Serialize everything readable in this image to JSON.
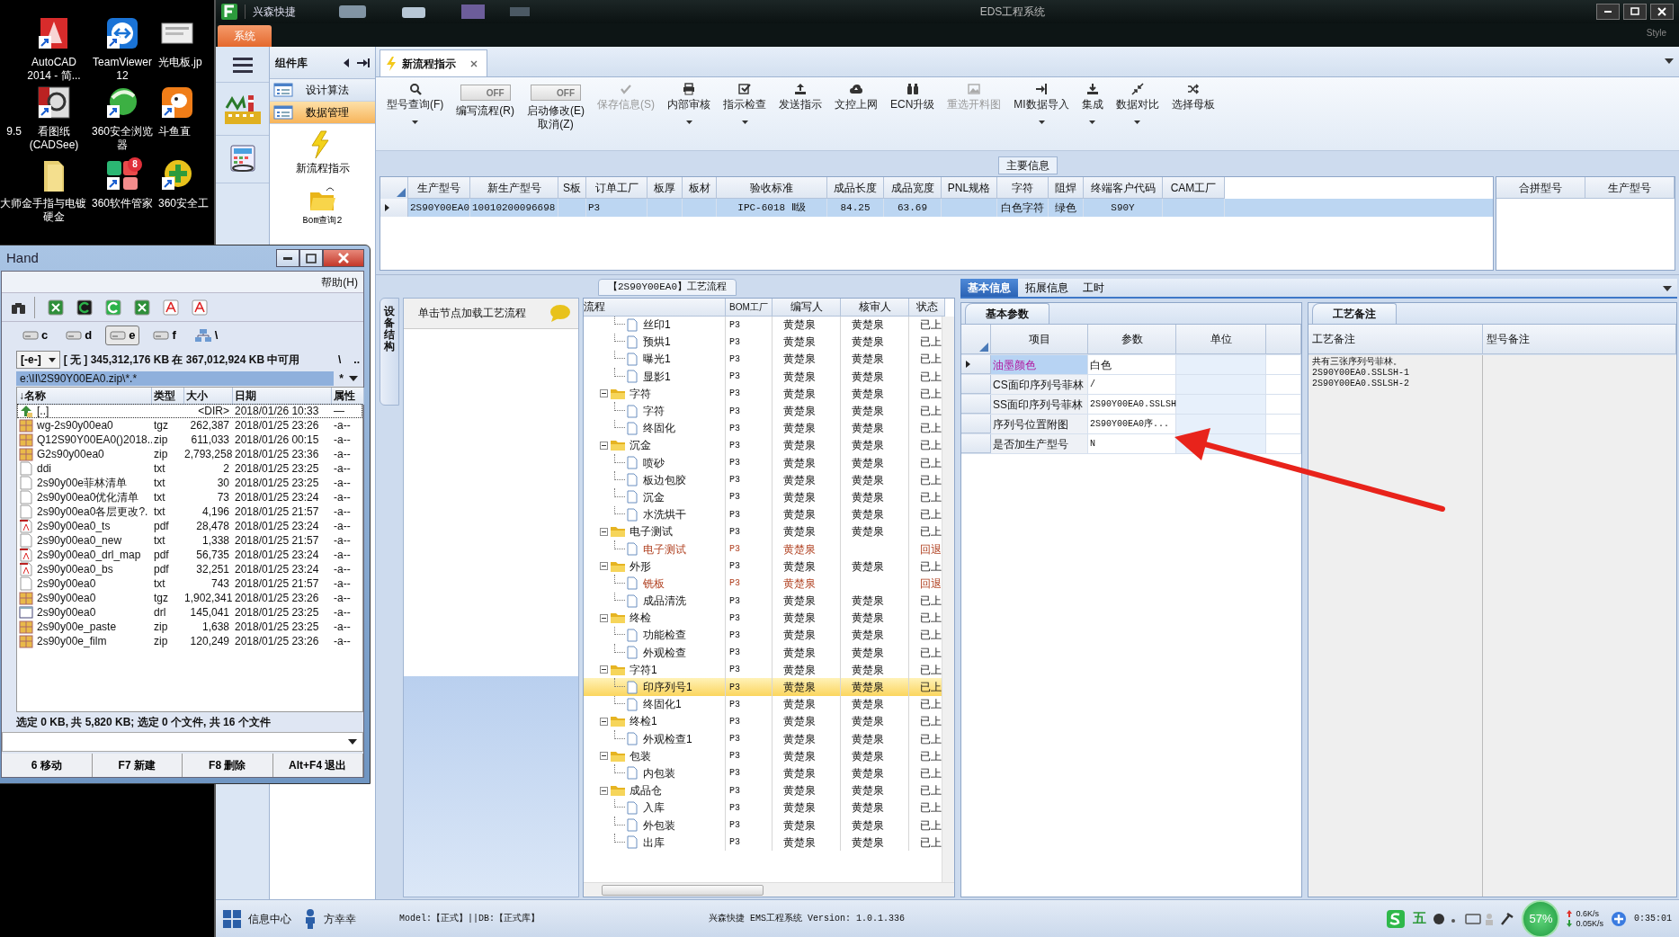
{
  "desktop": {
    "icons": [
      {
        "label": "AutoCAD 2014 - 简..."
      },
      {
        "label": "TeamViewer 12"
      },
      {
        "label": "光电板.jp"
      },
      {
        "label": "9.5"
      },
      {
        "label": "看图纸 (CADSee)"
      },
      {
        "label": "360安全浏览器"
      },
      {
        "label": "斗鱼直"
      },
      {
        "label": "大师"
      },
      {
        "label": "金手指与电镀硬金"
      },
      {
        "label": "360软件管家",
        "badge": "8"
      },
      {
        "label": "360安全工"
      }
    ]
  },
  "app": {
    "brand": "兴森快捷",
    "title": "EDS工程系统",
    "style_label": "Style",
    "ribbon_tab": {
      "label": "系统",
      "selected": true
    },
    "sidebar": {
      "title": "组件库",
      "items": [
        {
          "label": "设计算法",
          "selected": false
        },
        {
          "label": "数据管理",
          "selected": true
        }
      ],
      "shortcuts": [
        {
          "label": "新流程指示"
        },
        {
          "label": "Bom查询2"
        }
      ]
    },
    "doc_tab": {
      "label": "新流程指示"
    },
    "toolbar": [
      {
        "kind": "button",
        "label": "型号查询(F)",
        "dropdown": true,
        "disabled": false
      },
      {
        "kind": "toggle",
        "switch": "OFF",
        "on": false,
        "label": "编写流程(R)"
      },
      {
        "kind": "toggle",
        "switch": "OFF",
        "on": false,
        "label": "启动修改(E)\n取消(Z)"
      },
      {
        "kind": "button",
        "label": "保存信息(S)",
        "dropdown": false,
        "disabled": true
      },
      {
        "kind": "button",
        "label": "内部审核",
        "dropdown": true,
        "disabled": false
      },
      {
        "kind": "button",
        "label": "指示检查",
        "dropdown": true,
        "disabled": false
      },
      {
        "kind": "button",
        "label": "发送指示",
        "dropdown": false,
        "disabled": false
      },
      {
        "kind": "button",
        "label": "文控上网",
        "dropdown": false,
        "disabled": false
      },
      {
        "kind": "button",
        "label": "ECN升级",
        "dropdown": false,
        "disabled": false
      },
      {
        "kind": "button",
        "label": "重选开料图",
        "dropdown": false,
        "disabled": true
      },
      {
        "kind": "button",
        "label": "MI数据导入",
        "dropdown": true,
        "disabled": false
      },
      {
        "kind": "button",
        "label": "集成",
        "dropdown": true,
        "disabled": false
      },
      {
        "kind": "button",
        "label": "数据对比",
        "dropdown": true,
        "disabled": false
      },
      {
        "kind": "button",
        "label": "选择母板",
        "dropdown": false,
        "disabled": false
      }
    ],
    "main_info": {
      "title": "主要信息",
      "columns": [
        "生产型号",
        "新生产型号",
        "S板",
        "订单工厂",
        "板厚",
        "板材",
        "验收标准",
        "成品长度",
        "成品宽度",
        "PNL规格",
        "字符",
        "阻焊",
        "终端客户代码",
        "CAM工厂"
      ],
      "rows": [
        {
          "selected": true,
          "cells": [
            "2S90Y00EA0",
            "10010200096698",
            null,
            "P3",
            null,
            null,
            "IPC-6018 Ⅱ级",
            "84.25",
            "63.69",
            null,
            "白色字符",
            "绿色",
            "S90Y",
            null
          ]
        }
      ],
      "side_columns": [
        "合拼型号",
        "生产型号"
      ]
    },
    "process": {
      "title": "【2S90Y00EA0】工艺流程",
      "side_tab": "设备结构",
      "hint": "单击节点加载工艺流程",
      "columns": [
        "流程",
        "BOM工厂",
        "编写人",
        "核审人",
        "状态"
      ],
      "continued_children": [
        {
          "label": "丝印1",
          "bom": "P3",
          "writer": "黄楚泉",
          "reviewer": "黄楚泉",
          "status": "已上",
          "returned": false,
          "selected": false
        },
        {
          "label": "预烘1",
          "bom": "P3",
          "writer": "黄楚泉",
          "reviewer": "黄楚泉",
          "status": "已上",
          "returned": false,
          "selected": false
        },
        {
          "label": "曝光1",
          "bom": "P3",
          "writer": "黄楚泉",
          "reviewer": "黄楚泉",
          "status": "已上",
          "returned": false,
          "selected": false
        },
        {
          "label": "显影1",
          "bom": "P3",
          "writer": "黄楚泉",
          "reviewer": "黄楚泉",
          "status": "已上",
          "returned": false,
          "selected": false
        }
      ],
      "nodes": [
        {
          "label": "字符",
          "bom": "P3",
          "writer": "黄楚泉",
          "reviewer": "黄楚泉",
          "status": "已上",
          "returned": false,
          "selected": false,
          "expanded": true,
          "children": [
            {
              "label": "字符",
              "bom": "P3",
              "writer": "黄楚泉",
              "reviewer": "黄楚泉",
              "status": "已上",
              "returned": false,
              "selected": false
            },
            {
              "label": "终固化",
              "bom": "P3",
              "writer": "黄楚泉",
              "reviewer": "黄楚泉",
              "status": "已上",
              "returned": false,
              "selected": false
            }
          ]
        },
        {
          "label": "沉金",
          "bom": "P3",
          "writer": "黄楚泉",
          "reviewer": "黄楚泉",
          "status": "已上",
          "returned": false,
          "selected": false,
          "expanded": true,
          "children": [
            {
              "label": "喷砂",
              "bom": "P3",
              "writer": "黄楚泉",
              "reviewer": "黄楚泉",
              "status": "已上",
              "returned": false,
              "selected": false
            },
            {
              "label": "板边包胶",
              "bom": "P3",
              "writer": "黄楚泉",
              "reviewer": "黄楚泉",
              "status": "已上",
              "returned": false,
              "selected": false
            },
            {
              "label": "沉金",
              "bom": "P3",
              "writer": "黄楚泉",
              "reviewer": "黄楚泉",
              "status": "已上",
              "returned": false,
              "selected": false
            },
            {
              "label": "水洗烘干",
              "bom": "P3",
              "writer": "黄楚泉",
              "reviewer": "黄楚泉",
              "status": "已上",
              "returned": false,
              "selected": false
            }
          ]
        },
        {
          "label": "电子测试",
          "bom": "P3",
          "writer": "黄楚泉",
          "reviewer": "黄楚泉",
          "status": "已上",
          "returned": false,
          "selected": false,
          "expanded": true,
          "children": [
            {
              "label": "电子测试",
              "bom": "P3",
              "writer": "黄楚泉",
              "status": "回退",
              "returned": true,
              "selected": false
            }
          ]
        },
        {
          "label": "外形",
          "bom": "P3",
          "writer": "黄楚泉",
          "reviewer": "黄楚泉",
          "status": "已上",
          "returned": false,
          "selected": false,
          "expanded": true,
          "children": [
            {
              "label": "铣板",
              "bom": "P3",
              "writer": "黄楚泉",
              "status": "回退",
              "returned": true,
              "selected": false
            },
            {
              "label": "成品清洗",
              "bom": "P3",
              "writer": "黄楚泉",
              "reviewer": "黄楚泉",
              "status": "已上",
              "returned": false,
              "selected": false
            }
          ]
        },
        {
          "label": "终检",
          "bom": "P3",
          "writer": "黄楚泉",
          "reviewer": "黄楚泉",
          "status": "已上",
          "returned": false,
          "selected": false,
          "expanded": true,
          "children": [
            {
              "label": "功能检查",
              "bom": "P3",
              "writer": "黄楚泉",
              "reviewer": "黄楚泉",
              "status": "已上",
              "returned": false,
              "selected": false
            },
            {
              "label": "外观检查",
              "bom": "P3",
              "writer": "黄楚泉",
              "reviewer": "黄楚泉",
              "status": "已上",
              "returned": false,
              "selected": false
            }
          ]
        },
        {
          "label": "字符1",
          "bom": "P3",
          "writer": "黄楚泉",
          "reviewer": "黄楚泉",
          "status": "已上",
          "returned": false,
          "selected": false,
          "expanded": true,
          "children": [
            {
              "label": "印序列号1",
              "bom": "P3",
              "writer": "黄楚泉",
              "reviewer": "黄楚泉",
              "status": "已上",
              "returned": false,
              "selected": true
            },
            {
              "label": "终固化1",
              "bom": "P3",
              "writer": "黄楚泉",
              "reviewer": "黄楚泉",
              "status": "已上",
              "returned": false,
              "selected": false
            }
          ]
        },
        {
          "label": "终检1",
          "bom": "P3",
          "writer": "黄楚泉",
          "reviewer": "黄楚泉",
          "status": "已上",
          "returned": false,
          "selected": false,
          "expanded": true,
          "children": [
            {
              "label": "外观检查1",
              "bom": "P3",
              "writer": "黄楚泉",
              "reviewer": "黄楚泉",
              "status": "已上",
              "returned": false,
              "selected": false
            }
          ]
        },
        {
          "label": "包装",
          "bom": "P3",
          "writer": "黄楚泉",
          "reviewer": "黄楚泉",
          "status": "已上",
          "returned": false,
          "selected": false,
          "expanded": true,
          "children": [
            {
              "label": "内包装",
              "bom": "P3",
              "writer": "黄楚泉",
              "reviewer": "黄楚泉",
              "status": "已上",
              "returned": false,
              "selected": false
            }
          ]
        },
        {
          "label": "成品仓",
          "bom": "P3",
          "writer": "黄楚泉",
          "reviewer": "黄楚泉",
          "status": "已上",
          "returned": false,
          "selected": false,
          "expanded": true,
          "children": [
            {
              "label": "入库",
              "bom": "P3",
              "writer": "黄楚泉",
              "reviewer": "黄楚泉",
              "status": "已上",
              "returned": false,
              "selected": false
            },
            {
              "label": "外包装",
              "bom": "P3",
              "writer": "黄楚泉",
              "reviewer": "黄楚泉",
              "status": "已上",
              "returned": false,
              "selected": false
            },
            {
              "label": "出库",
              "bom": "P3",
              "writer": "黄楚泉",
              "reviewer": "黄楚泉",
              "status": "已上",
              "returned": false,
              "selected": false
            }
          ]
        }
      ]
    },
    "details": {
      "tabs": [
        {
          "label": "基本信息",
          "selected": true
        },
        {
          "label": "拓展信息",
          "selected": false
        },
        {
          "label": "工时",
          "selected": false
        }
      ],
      "params": {
        "tab": "基本参数",
        "columns": [
          "项目",
          "参数",
          "单位"
        ],
        "rows": [
          {
            "item": "油墨颜色",
            "value": "白色",
            "current": true
          },
          {
            "item": "CS面印序列号菲林",
            "value": "/",
            "current": false
          },
          {
            "item": "SS面印序列号菲林",
            "value": "2S90Y00EA0.SSLSH",
            "current": false
          },
          {
            "item": "序列号位置附图",
            "value": "2S90Y00EA0序...",
            "current": false
          },
          {
            "item": "是否加生产型号",
            "value": "N",
            "current": false
          }
        ]
      },
      "notes": {
        "tab": "工艺备注",
        "columns": [
          "工艺备注",
          "型号备注"
        ],
        "process_note": "共有三张序列号菲林。\n2S90Y00EA0.SSLSH-1\n2S90Y00EA0.SSLSH-2"
      }
    },
    "status_bar": {
      "info_center": "信息中心",
      "user": "方幸幸",
      "model": "Model:【正式】||DB:【正式库】",
      "version": "兴森快捷 EMS工程系统 Version: 1.0.1.336",
      "tray": {
        "ime": "五",
        "cpu": "57%",
        "up": "0.6K/s",
        "down": "0.05K/s",
        "clock": "0:35:01"
      }
    }
  },
  "file_manager": {
    "title": "Hand",
    "menu": "帮助(H)",
    "drives": [
      {
        "kind": "drive",
        "label": "c",
        "selected": false
      },
      {
        "kind": "drive",
        "label": "d",
        "selected": false
      },
      {
        "kind": "drive",
        "label": "e",
        "selected": true
      },
      {
        "kind": "drive",
        "label": "f",
        "selected": false
      },
      {
        "kind": "network",
        "label": "\\",
        "selected": false
      }
    ],
    "drive_combo": "[-e-]",
    "free_space": "[ 无 ]  345,312,176 KB 在 367,012,924 KB 中可用",
    "root_button": "\\",
    "up_button": "..",
    "path": "e:\\II\\2S90Y00EA0.zip\\*.*",
    "filter": "*",
    "columns": [
      "↓名称",
      "类型",
      "大小",
      "日期",
      "属性"
    ],
    "files": [
      {
        "kind": "parent",
        "name": "[..]",
        "size": "<DIR>",
        "date": "2018/01/26 10:33",
        "attr": "—",
        "selected": true
      },
      {
        "kind": "archive",
        "name": "wg-2s90y00ea0",
        "type": "tgz",
        "size": "262,387",
        "date": "2018/01/25 23:26",
        "attr": "-a--",
        "selected": false
      },
      {
        "kind": "archive",
        "name": "Q12S90Y00EA0()2018..",
        "type": "zip",
        "size": "611,033",
        "date": "2018/01/26 00:15",
        "attr": "-a--",
        "selected": false
      },
      {
        "kind": "archive",
        "name": "G2s90y00ea0",
        "type": "zip",
        "size": "2,793,258",
        "date": "2018/01/25 23:36",
        "attr": "-a--",
        "selected": false
      },
      {
        "kind": "text",
        "name": "ddi",
        "type": "txt",
        "size": "2",
        "date": "2018/01/25 23:25",
        "attr": "-a--",
        "selected": false
      },
      {
        "kind": "text",
        "name": "2s90y00e菲林清单",
        "type": "txt",
        "size": "30",
        "date": "2018/01/25 23:25",
        "attr": "-a--",
        "selected": false
      },
      {
        "kind": "text",
        "name": "2s90y00ea0优化清单",
        "type": "txt",
        "size": "73",
        "date": "2018/01/25 23:24",
        "attr": "-a--",
        "selected": false
      },
      {
        "kind": "text",
        "name": "2s90y00ea0各层更改?.",
        "type": "txt",
        "size": "4,196",
        "date": "2018/01/25 21:57",
        "attr": "-a--",
        "selected": false
      },
      {
        "kind": "pdf",
        "name": "2s90y00ea0_ts",
        "type": "pdf",
        "size": "28,478",
        "date": "2018/01/25 23:24",
        "attr": "-a--",
        "selected": false
      },
      {
        "kind": "text",
        "name": "2s90y00ea0_new",
        "type": "txt",
        "size": "1,338",
        "date": "2018/01/25 21:57",
        "attr": "-a--",
        "selected": false
      },
      {
        "kind": "pdf",
        "name": "2s90y00ea0_drl_map",
        "type": "pdf",
        "size": "56,735",
        "date": "2018/01/25 23:24",
        "attr": "-a--",
        "selected": false
      },
      {
        "kind": "pdf",
        "name": "2s90y00ea0_bs",
        "type": "pdf",
        "size": "32,251",
        "date": "2018/01/25 23:24",
        "attr": "-a--",
        "selected": false
      },
      {
        "kind": "text",
        "name": "2s90y00ea0",
        "type": "txt",
        "size": "743",
        "date": "2018/01/25 21:57",
        "attr": "-a--",
        "selected": false
      },
      {
        "kind": "archive",
        "name": "2s90y00ea0",
        "type": "tgz",
        "size": "1,902,341",
        "date": "2018/01/25 23:26",
        "attr": "-a--",
        "selected": false
      },
      {
        "kind": "drill",
        "name": "2s90y00ea0",
        "type": "drl",
        "size": "145,041",
        "date": "2018/01/25 23:25",
        "attr": "-a--",
        "selected": false
      },
      {
        "kind": "archive",
        "name": "2s90y00e_paste",
        "type": "zip",
        "size": "1,638",
        "date": "2018/01/25 23:25",
        "attr": "-a--",
        "selected": false
      },
      {
        "kind": "archive",
        "name": "2s90y00e_film",
        "type": "zip",
        "size": "120,249",
        "date": "2018/01/25 23:26",
        "attr": "-a--",
        "selected": false
      }
    ],
    "summary": "选定 0 KB, 共 5,820 KB; 选定 0 个文件, 共 16 个文件",
    "function_keys": [
      "6 移动",
      "F7 新建",
      "F8 删除",
      "Alt+F4 退出"
    ]
  }
}
